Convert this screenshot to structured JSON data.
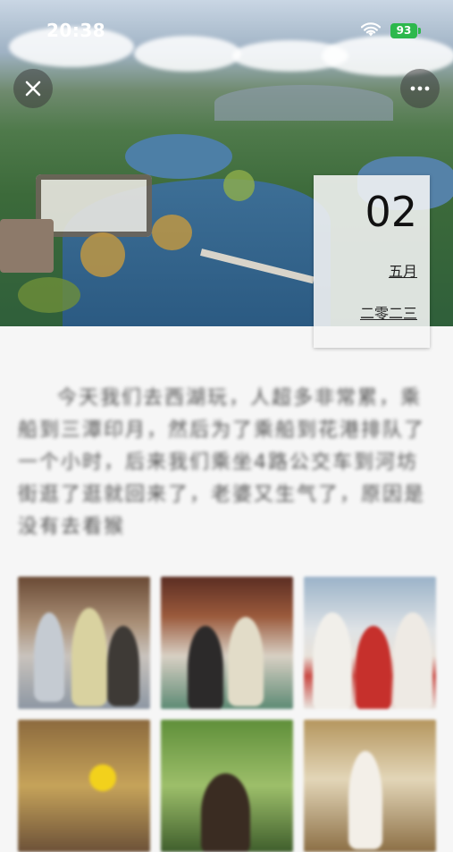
{
  "status_bar": {
    "time": "20:38",
    "battery": "93"
  },
  "date_card": {
    "day": "02",
    "month": "五月",
    "year": "二零二三"
  },
  "body_text": "今天我们去西湖玩，人超多非常累，乘船到三潭印月，然后为了乘船到花港排队了一个小时，后来我们乘坐4路公交车到河坊街逛了逛就回来了，老婆又生气了，原因是没有去看猴",
  "icons": {
    "close": "close-icon",
    "more": "more-icon",
    "wifi": "wifi-icon",
    "battery": "battery-icon"
  },
  "photos": [
    "photo-1",
    "photo-2",
    "photo-3",
    "photo-4",
    "photo-5",
    "photo-6"
  ]
}
